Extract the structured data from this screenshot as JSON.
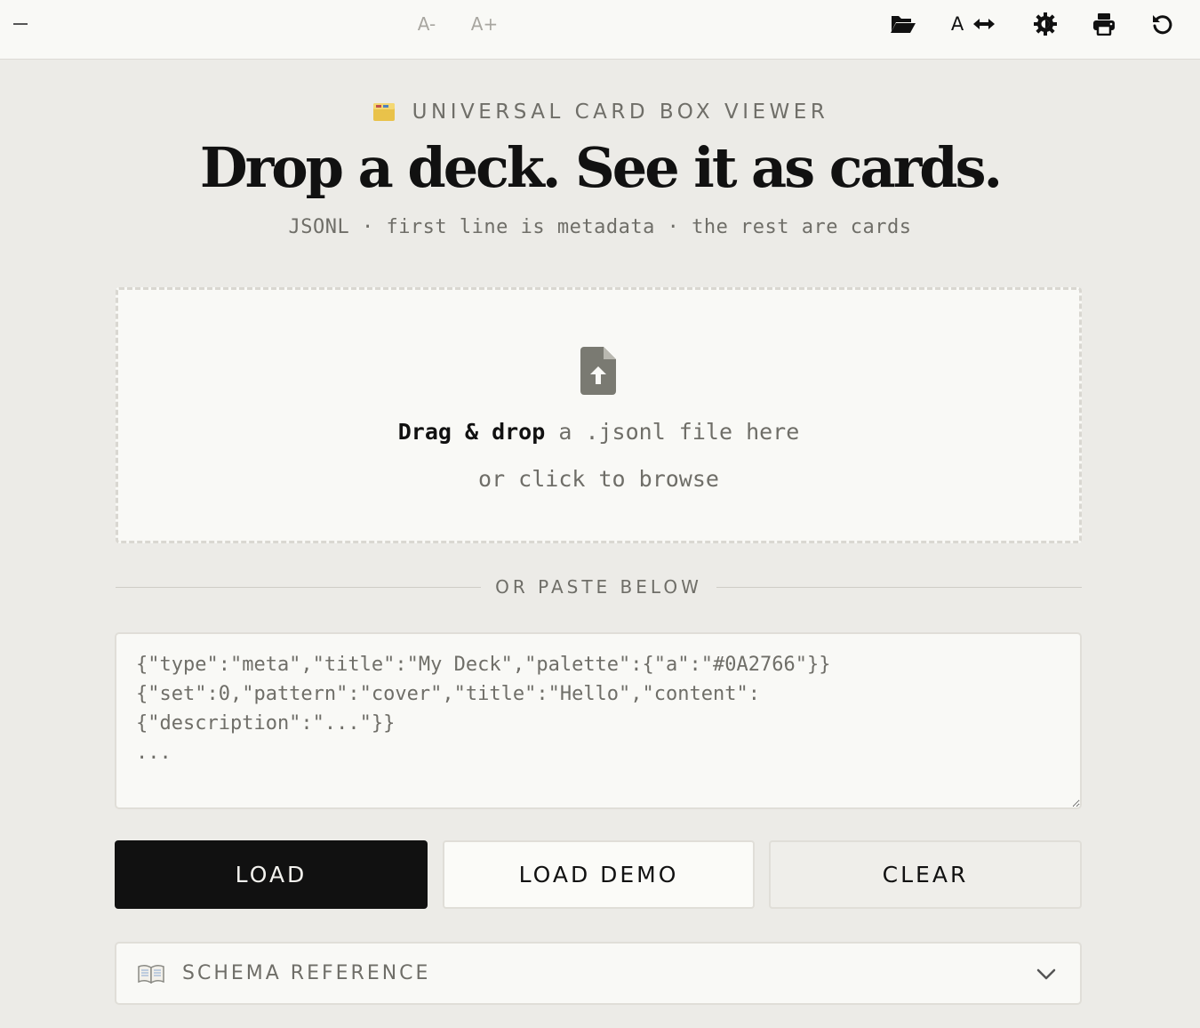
{
  "toolbar": {
    "font_decrease": "A-",
    "font_increase": "A+",
    "width_toggle_letter": "A",
    "icons": [
      "minimize-icon",
      "folder-open-icon",
      "width-arrows-icon",
      "theme-gear-icon",
      "print-icon",
      "reset-icon"
    ]
  },
  "header": {
    "eyebrow": "UNIVERSAL CARD BOX VIEWER",
    "title": "Drop a deck. See it as cards.",
    "subtitle": "JSONL · first line is metadata · the rest are cards"
  },
  "dropzone": {
    "strong": "Drag & drop",
    "rest": " a .jsonl file here",
    "secondary": "or click to browse"
  },
  "divider": {
    "label": "OR PASTE BELOW"
  },
  "paste": {
    "placeholder": "{\"type\":\"meta\",\"title\":\"My Deck\",\"palette\":{\"a\":\"#0A2766\"}}\n{\"set\":0,\"pattern\":\"cover\",\"title\":\"Hello\",\"content\":\n{\"description\":\"...\"}}\n...",
    "value": ""
  },
  "buttons": {
    "load": "LOAD",
    "load_demo": "LOAD DEMO",
    "clear": "CLEAR"
  },
  "schema": {
    "label": "SCHEMA REFERENCE"
  },
  "colors": {
    "background": "#ecebe7",
    "surface": "#f9f9f6",
    "primary_button": "#111111",
    "muted_text": "#6f6e68",
    "icon_gray": "#7a7a72"
  }
}
